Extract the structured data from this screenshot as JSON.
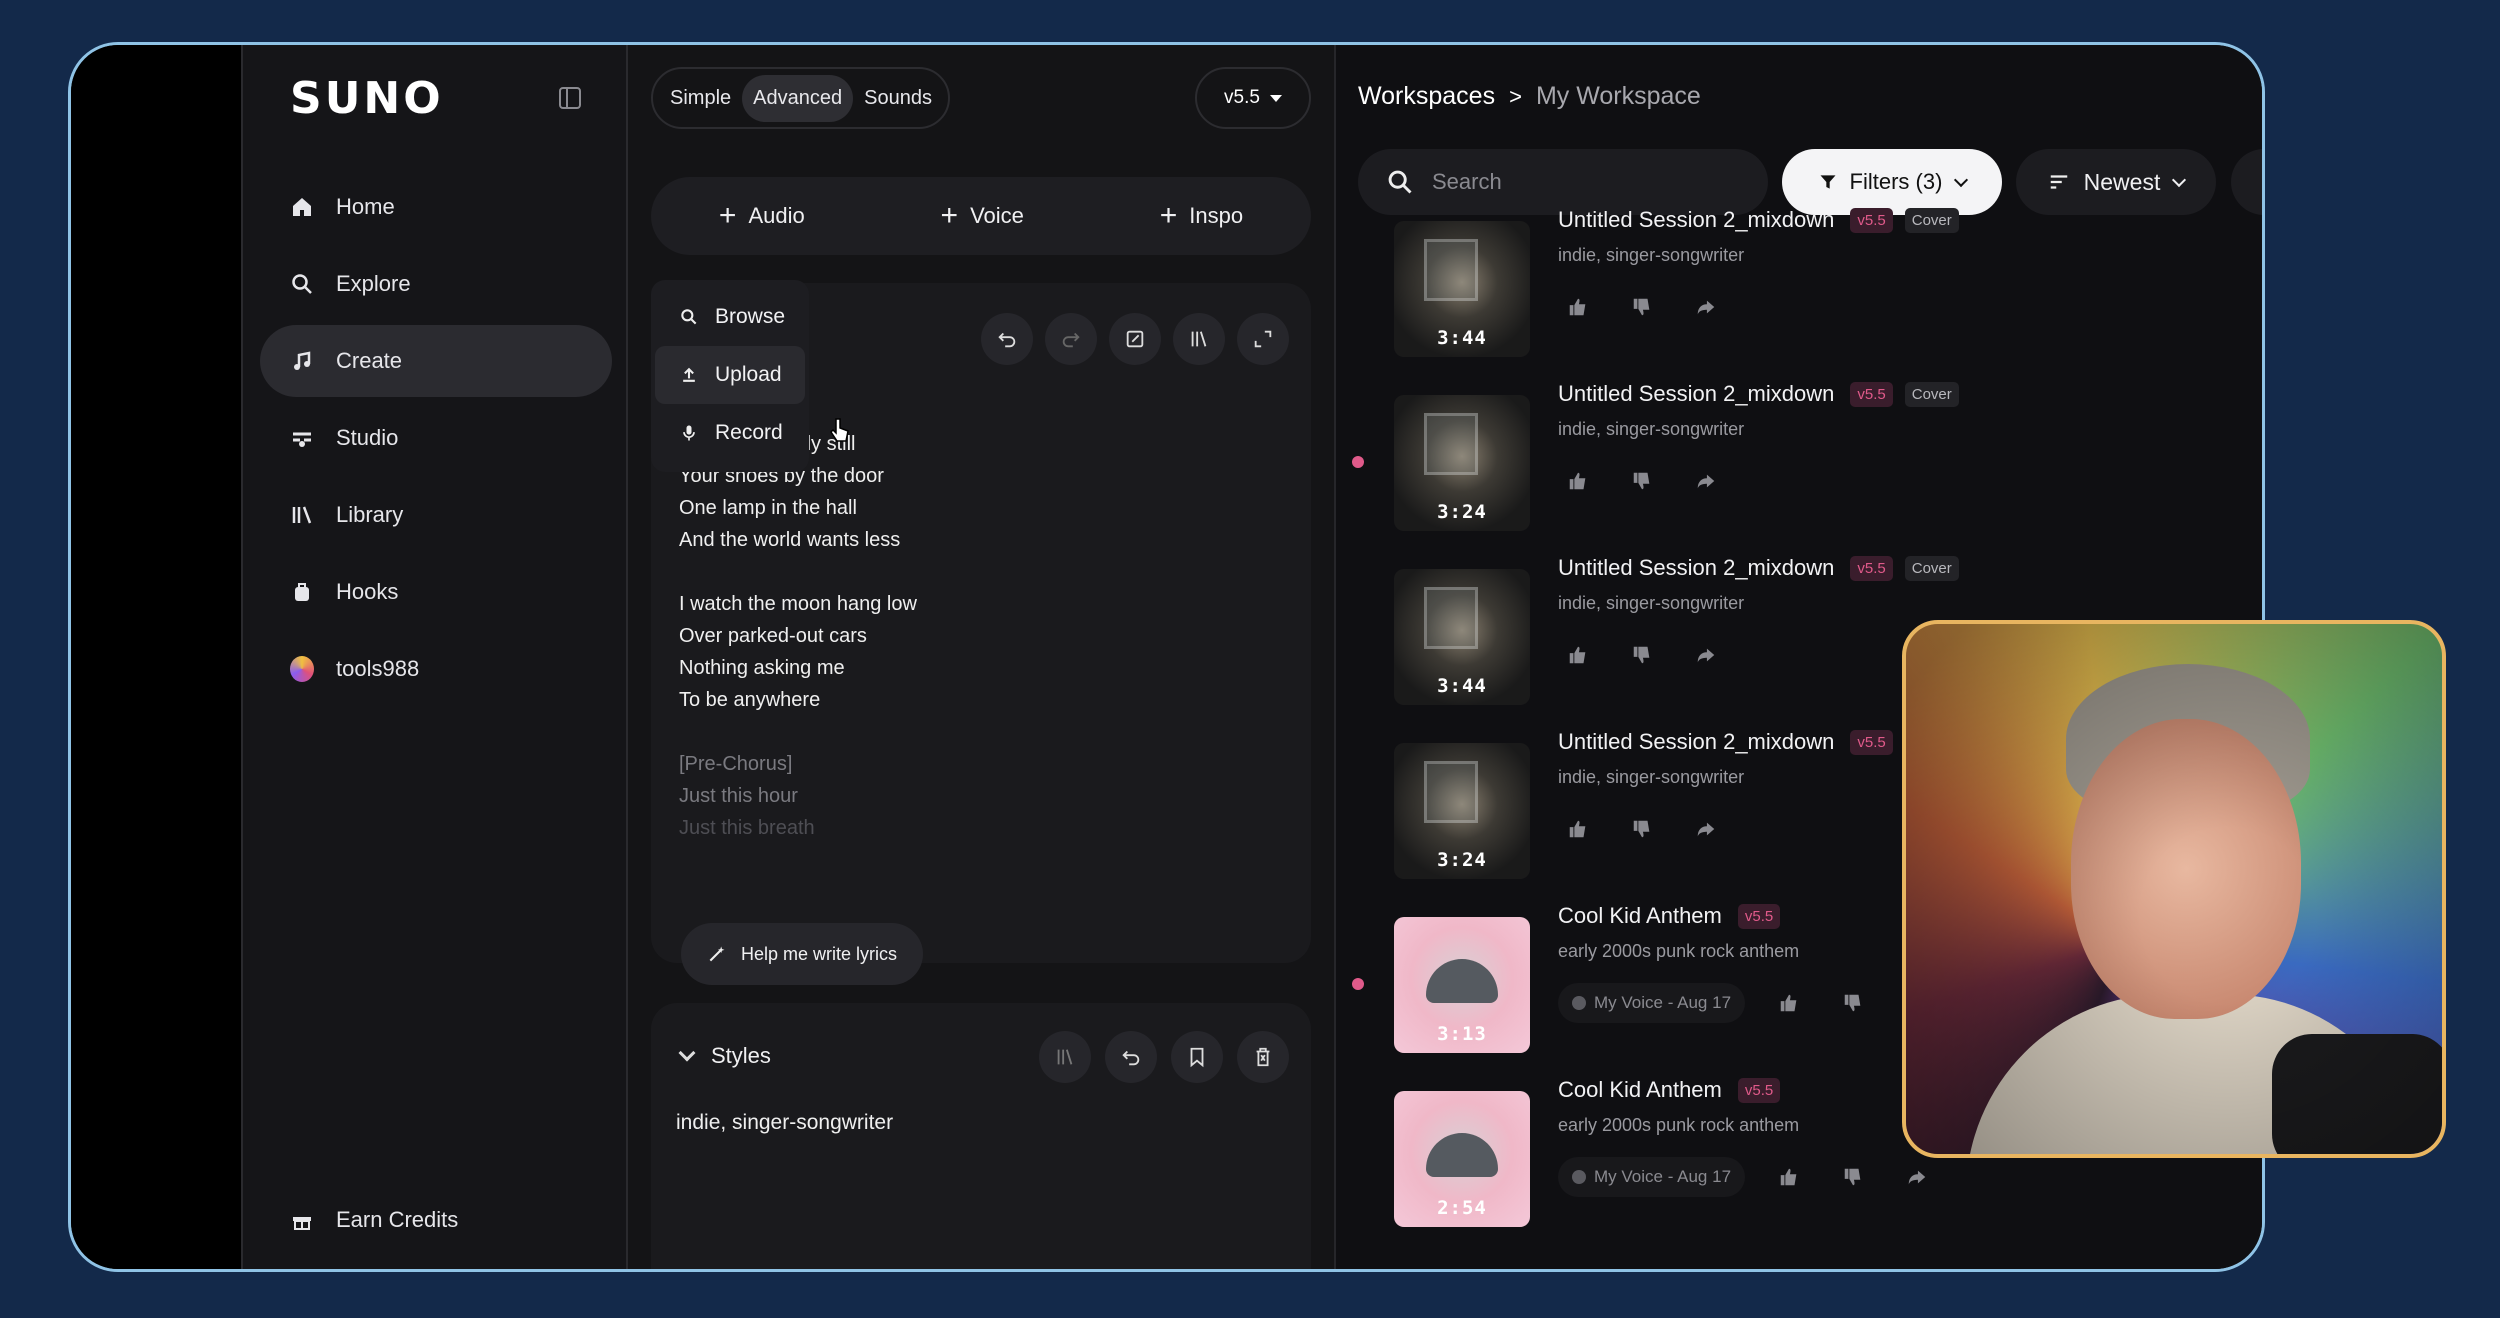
{
  "sidebar": {
    "logo": "SUNO",
    "items": [
      {
        "label": "Home",
        "icon": "home-icon"
      },
      {
        "label": "Explore",
        "icon": "search-icon"
      },
      {
        "label": "Create",
        "icon": "create-icon",
        "active": true
      },
      {
        "label": "Studio",
        "icon": "studio-icon"
      },
      {
        "label": "Library",
        "icon": "library-icon"
      },
      {
        "label": "Hooks",
        "icon": "hooks-icon"
      },
      {
        "label": "tools988",
        "icon": "avatar"
      }
    ],
    "earn_credits": "Earn Credits"
  },
  "create": {
    "tabs": [
      "Simple",
      "Advanced",
      "Sounds"
    ],
    "active_tab": "Advanced",
    "version": "v5.5",
    "add_buttons": [
      "Audio",
      "Voice",
      "Inspo"
    ],
    "dropdown": [
      "Browse",
      "Upload",
      "Record"
    ],
    "lyrics": {
      "line0": "ally still",
      "line1": "Your shoes by the door",
      "line2": "One lamp in the hall",
      "line3": "And the world wants less",
      "line4": "I watch the moon hang low",
      "line5": "Over parked-out cars",
      "line6": "Nothing asking me",
      "line7": "To be anywhere",
      "line8": "[Pre-Chorus]",
      "line9": "Just this hour",
      "line10": "Just this breath"
    },
    "help_button": "Help me write lyrics",
    "styles_label": "Styles",
    "styles_value": "indie, singer-songwriter"
  },
  "workspace": {
    "breadcrumb": [
      "Workspaces",
      "My Workspace"
    ],
    "search_placeholder": "Search",
    "filters": "Filters (3)",
    "sort": "Newest",
    "songs": [
      {
        "title": "Untitled Session 2_mixdown",
        "version": "v5.5",
        "cover": "Cover",
        "style": "indie, singer-songwriter",
        "duration": "3:44"
      },
      {
        "title": "Untitled Session 2_mixdown",
        "version": "v5.5",
        "cover": "Cover",
        "style": "indie, singer-songwriter",
        "duration": "3:24"
      },
      {
        "title": "Untitled Session 2_mixdown",
        "version": "v5.5",
        "cover": "Cover",
        "style": "indie, singer-songwriter",
        "duration": "3:44"
      },
      {
        "title": "Untitled Session 2_mixdown",
        "version": "v5.5",
        "style": "indie, singer-songwriter",
        "duration": "3:24"
      },
      {
        "title": "Cool Kid Anthem",
        "version": "v5.5",
        "style": "early 2000s punk rock anthem",
        "duration": "3:13",
        "voice": "My Voice - Aug 17"
      },
      {
        "title": "Cool Kid Anthem",
        "version": "v5.5",
        "style": "early 2000s punk rock anthem",
        "duration": "2:54",
        "voice": "My Voice - Aug 17"
      }
    ]
  },
  "colors": {
    "accent_pink": "#e05a8a",
    "frame_border": "#8fc3e6",
    "background": "#13294a"
  }
}
